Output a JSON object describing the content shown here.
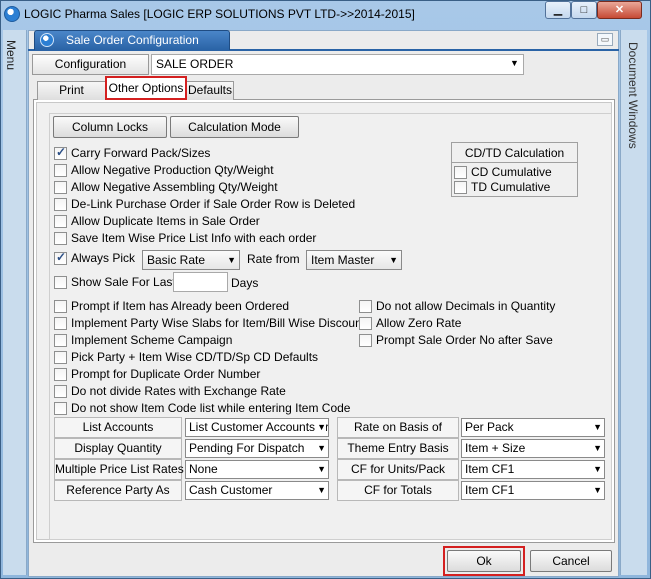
{
  "window": {
    "title": "LOGIC Pharma Sales  [LOGIC ERP SOLUTIONS PVT LTD->>2014-2015]",
    "min_glyph": "▁",
    "max_glyph": "□",
    "close_glyph": "✕"
  },
  "side_panels": {
    "menu_label": "Menu",
    "document_windows_label": "Document Windows"
  },
  "document_tab": {
    "label": "Sale Order Configuration",
    "collapse_glyph": "▭"
  },
  "configuration": {
    "label": "Configuration",
    "selected": "SALE ORDER"
  },
  "tabs": [
    {
      "label": "Print Options",
      "active": false
    },
    {
      "label": "Other Options",
      "active": true
    },
    {
      "label": "Defaults",
      "active": false
    }
  ],
  "buttons": {
    "column_locks": "Column Locks",
    "calculation_mode": "Calculation Mode",
    "ok": "Ok",
    "cancel": "Cancel"
  },
  "options_top": [
    {
      "label": "Carry Forward Pack/Sizes",
      "checked": true
    },
    {
      "label": "Allow Negative Production Qty/Weight",
      "checked": false
    },
    {
      "label": "Allow Negative Assembling Qty/Weight",
      "checked": false
    },
    {
      "label": "De-Link Purchase Order if Sale Order Row is Deleted",
      "checked": false
    },
    {
      "label": "Allow Duplicate Items in Sale Order",
      "checked": false
    },
    {
      "label": "Save Item Wise Price List Info with each order",
      "checked": false
    }
  ],
  "always_pick": {
    "label": "Always Pick",
    "checked": true,
    "rate_value": "Basic Rate",
    "rate_from_label": "Rate from",
    "rate_from_value": "Item Master"
  },
  "show_sale": {
    "label": "Show Sale For Last",
    "checked": false,
    "days_value": "",
    "days_label": "Days"
  },
  "cdtd": {
    "title": "CD/TD Calculation",
    "cd_cumulative": {
      "label": "CD Cumulative",
      "checked": false
    },
    "td_cumulative": {
      "label": "TD Cumulative",
      "checked": false
    }
  },
  "options_left": [
    {
      "label": "Prompt  if Item has Already been Ordered",
      "checked": false
    },
    {
      "label": "Implement Party Wise Slabs for Item/Bill Wise Discounts",
      "checked": false
    },
    {
      "label": "Implement Scheme Campaign",
      "checked": false
    },
    {
      "label": "Pick Party + Item Wise CD/TD/Sp CD Defaults",
      "checked": false
    },
    {
      "label": "Prompt for Duplicate Order Number",
      "checked": false
    },
    {
      "label": "Do not divide Rates with Exchange Rate",
      "checked": false
    },
    {
      "label": "Do not show Item Code list while entering Item Code",
      "checked": false
    }
  ],
  "options_right": [
    {
      "label": "Do not allow Decimals in Quantity",
      "checked": false
    },
    {
      "label": "Allow Zero Rate",
      "checked": false
    },
    {
      "label": "Prompt Sale Order No after Save",
      "checked": false
    }
  ],
  "settings_grid": {
    "left": [
      {
        "label": "List Accounts",
        "value": "List Customer Accounts or"
      },
      {
        "label": "Display Quantity",
        "value": "Pending For Dispatch"
      },
      {
        "label": "Multiple Price List Rates",
        "value": "None"
      },
      {
        "label": "Reference Party As",
        "value": "Cash Customer"
      }
    ],
    "right": [
      {
        "label": "Rate on Basis of",
        "value": "Per Pack"
      },
      {
        "label": "Theme Entry Basis",
        "value": "Item + Size"
      },
      {
        "label": "CF for Units/Pack",
        "value": "Item CF1"
      },
      {
        "label": "CF for Totals",
        "value": "Item CF1"
      }
    ]
  },
  "dropdown_glyph": "▼"
}
